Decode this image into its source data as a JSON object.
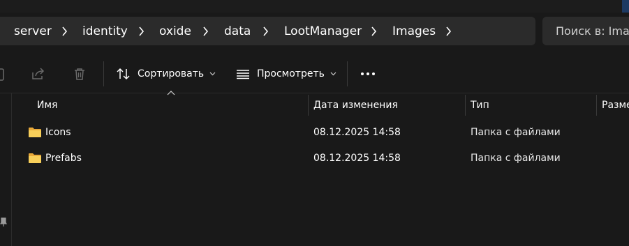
{
  "breadcrumb": [
    {
      "label": "server"
    },
    {
      "label": "identity"
    },
    {
      "label": "oxide"
    },
    {
      "label": "data"
    },
    {
      "label": "LootManager"
    },
    {
      "label": "Images"
    }
  ],
  "search": {
    "placeholder": "Поиск в: Images"
  },
  "toolbar": {
    "sort_label": "Сортировать",
    "view_label": "Просмотреть"
  },
  "columns": {
    "name": "Имя",
    "modified": "Дата изменения",
    "type": "Тип",
    "size": "Размер"
  },
  "files": [
    {
      "name": "Icons",
      "modified": "08.12.2025 14:58",
      "type": "Папка с файлами",
      "icon": "folder-icon"
    },
    {
      "name": "Prefabs",
      "modified": "08.12.2025 14:58",
      "type": "Папка с файлами",
      "icon": "folder-icon"
    }
  ],
  "colors": {
    "background": "#191919",
    "bar": "#2b2b2b",
    "folder": "#f4c14d"
  }
}
